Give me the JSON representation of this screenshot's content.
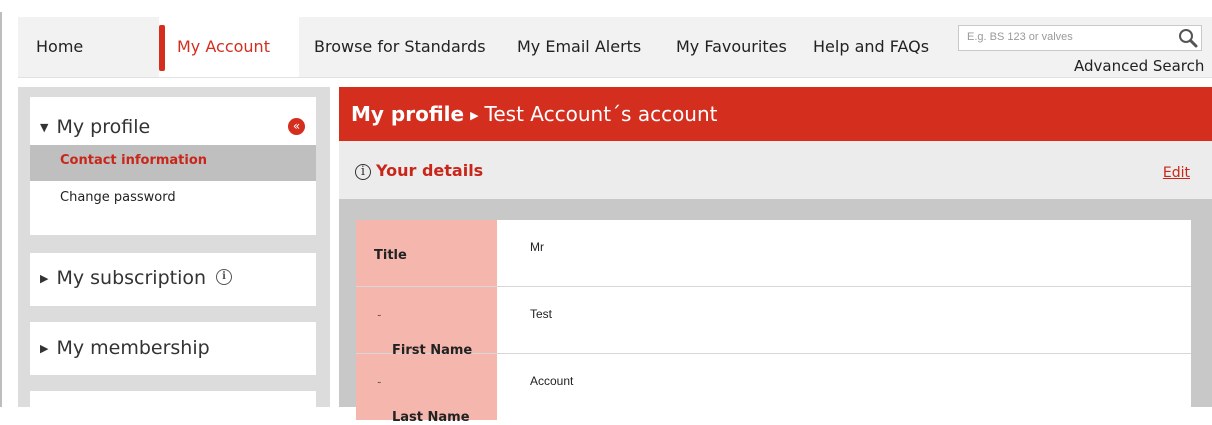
{
  "nav": {
    "home": "Home",
    "my_account": "My Account",
    "browse": "Browse for Standards",
    "email_alerts": "My Email Alerts",
    "favourites": "My Favourites",
    "help": "Help and FAQs"
  },
  "search": {
    "placeholder": "E.g. BS 123 or valves",
    "advanced": "Advanced Search",
    "icon": "search-icon"
  },
  "sidebar": {
    "profile": {
      "title": "My profile",
      "collapse_icon": "double-chevron-left-icon",
      "items": [
        "Contact information",
        "Change password"
      ],
      "active": "Contact information"
    },
    "subscription": "My subscription",
    "membership": "My membership"
  },
  "main": {
    "breadcrumb_section": "My profile",
    "breadcrumb_page": "Test Account´s account",
    "details_title": "Your details",
    "edit_label": "Edit",
    "fields": [
      {
        "label": "Title",
        "required": false,
        "value": "Mr"
      },
      {
        "label": "First Name",
        "required": true,
        "value": "Test"
      },
      {
        "label": "Last Name",
        "required": true,
        "value": "Account"
      }
    ]
  },
  "colors": {
    "accent": "#d42e1f",
    "label_bg": "#f5b7ad",
    "nav_bg": "#f2f2f2"
  }
}
